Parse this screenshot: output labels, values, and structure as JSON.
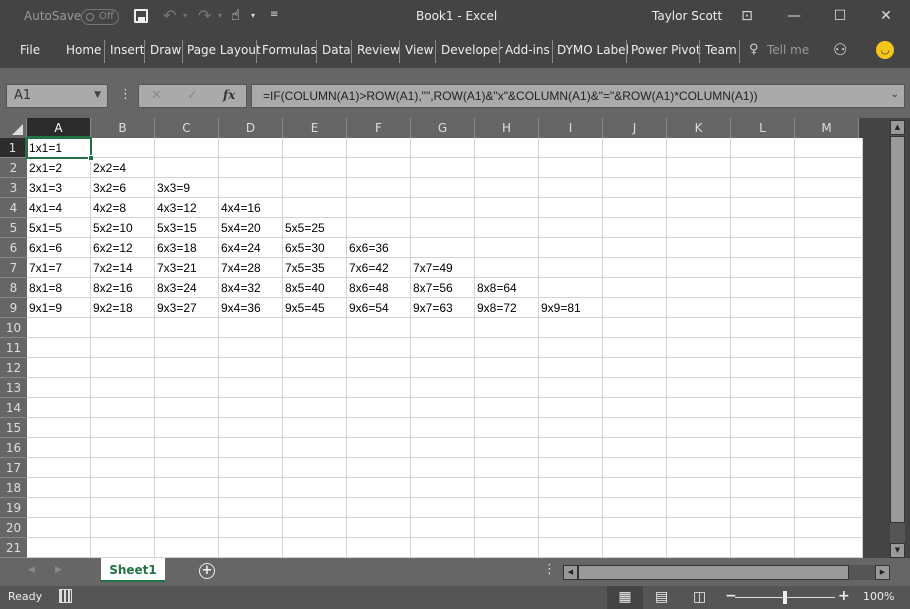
{
  "titlebar": {
    "autosave_label": "AutoSave",
    "autosave_state": "Off",
    "title": "Book1  -  Excel",
    "user": "Taylor Scott"
  },
  "ribbon": {
    "file": "File",
    "tabs": [
      "Home",
      "Insert",
      "Draw",
      "Page Layout",
      "Formulas",
      "Data",
      "Review",
      "View",
      "Developer",
      "Add-ins",
      "DYMO Label",
      "Power Pivot",
      "Team"
    ],
    "tell_me": "Tell me"
  },
  "formula_bar": {
    "name_box": "A1",
    "formula": "=IF(COLUMN(A1)>ROW(A1),\"\",ROW(A1)&\"x\"&COLUMN(A1)&\"=\"&ROW(A1)*COLUMN(A1))",
    "fx": "fx"
  },
  "grid": {
    "columns": [
      "A",
      "B",
      "C",
      "D",
      "E",
      "F",
      "G",
      "H",
      "I",
      "J",
      "K",
      "L",
      "M"
    ],
    "rows": [
      "1",
      "2",
      "3",
      "4",
      "5",
      "6",
      "7",
      "8",
      "9",
      "10",
      "11",
      "12",
      "13",
      "14",
      "15",
      "16",
      "17",
      "18",
      "19",
      "20",
      "21"
    ],
    "selected_cell": "A1",
    "cells": [
      [
        "1x1=1"
      ],
      [
        "2x1=2",
        "2x2=4"
      ],
      [
        "3x1=3",
        "3x2=6",
        "3x3=9"
      ],
      [
        "4x1=4",
        "4x2=8",
        "4x3=12",
        "4x4=16"
      ],
      [
        "5x1=5",
        "5x2=10",
        "5x3=15",
        "5x4=20",
        "5x5=25"
      ],
      [
        "6x1=6",
        "6x2=12",
        "6x3=18",
        "6x4=24",
        "6x5=30",
        "6x6=36"
      ],
      [
        "7x1=7",
        "7x2=14",
        "7x3=21",
        "7x4=28",
        "7x5=35",
        "7x6=42",
        "7x7=49"
      ],
      [
        "8x1=8",
        "8x2=16",
        "8x3=24",
        "8x4=32",
        "8x5=40",
        "8x6=48",
        "8x7=56",
        "8x8=64"
      ],
      [
        "9x1=9",
        "9x2=18",
        "9x3=27",
        "9x4=36",
        "9x5=45",
        "9x6=54",
        "9x7=63",
        "9x8=72",
        "9x9=81"
      ]
    ]
  },
  "sheets": {
    "tabs": [
      "Sheet1"
    ],
    "active": "Sheet1"
  },
  "status": {
    "mode": "Ready",
    "zoom": "100%",
    "zoom_level_percent": 100
  },
  "colors": {
    "accent": "#217346",
    "smiley": "#f5c518"
  }
}
